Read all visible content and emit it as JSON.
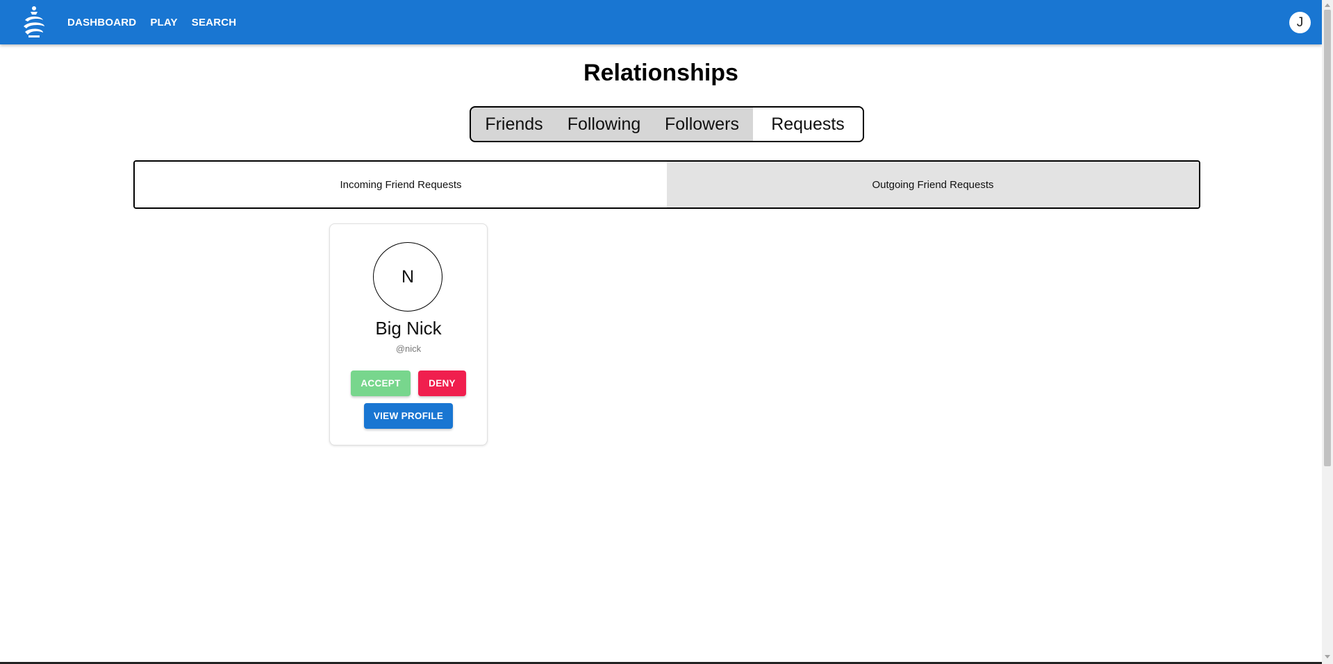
{
  "nav": {
    "logo_icon": "chess-swirl-logo-icon",
    "items": [
      "DASHBOARD",
      "PLAY",
      "SEARCH"
    ],
    "avatar_initial": "J"
  },
  "page": {
    "title": "Relationships"
  },
  "relationship_tabs": {
    "items": [
      "Friends",
      "Following",
      "Followers",
      "Requests"
    ],
    "active": "Requests"
  },
  "request_tabs": {
    "items": [
      "Incoming Friend Requests",
      "Outgoing Friend Requests"
    ],
    "active": "Incoming Friend Requests"
  },
  "requests": [
    {
      "initial": "N",
      "name": "Big Nick",
      "handle": "@nick",
      "accept_label": "ACCEPT",
      "deny_label": "DENY",
      "view_label": "VIEW PROFILE"
    }
  ],
  "colors": {
    "appbar": "#1976d2",
    "accept": "#78d68d",
    "deny": "#f01f4e",
    "view_profile": "#1976d2"
  }
}
